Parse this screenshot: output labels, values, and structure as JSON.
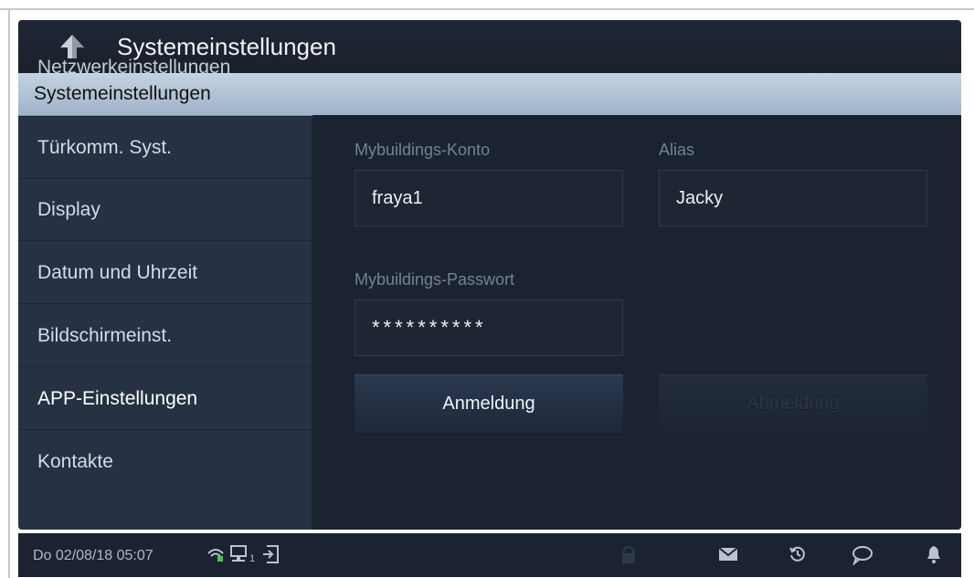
{
  "title": "Systemeinstellungen",
  "dropdown": {
    "selected": "Systemeinstellungen"
  },
  "sidebar": {
    "items": [
      {
        "label": "Netzwerkeinstellungen"
      },
      {
        "label": "Türkomm. Syst."
      },
      {
        "label": "Display"
      },
      {
        "label": "Datum und Uhrzeit"
      },
      {
        "label": "Bildschirmeinst."
      },
      {
        "label": "APP-Einstellungen",
        "active": true
      },
      {
        "label": "Kontakte"
      }
    ]
  },
  "form": {
    "account_label": "Mybuildings-Konto",
    "account_value": "fraya1",
    "alias_label": "Alias",
    "alias_value": "Jacky",
    "password_label": "Mybuildings-Passwort",
    "password_value": "**********",
    "login_label": "Anmeldung",
    "logout_label": "Abmeldung"
  },
  "status": {
    "datetime": "Do 02/08/18  05:07",
    "network_sub": "1"
  },
  "colors": {
    "background": "#1c2330",
    "sidebar": "#263244",
    "dropdown": "#b3c4d7",
    "label": "#6e8399",
    "text": "#eef1f4"
  },
  "icons": [
    "back-arrow-icon",
    "wifi-icon",
    "network-icon",
    "exit-icon",
    "lock-icon",
    "mail-icon",
    "history-icon",
    "chat-icon",
    "bell-icon"
  ]
}
